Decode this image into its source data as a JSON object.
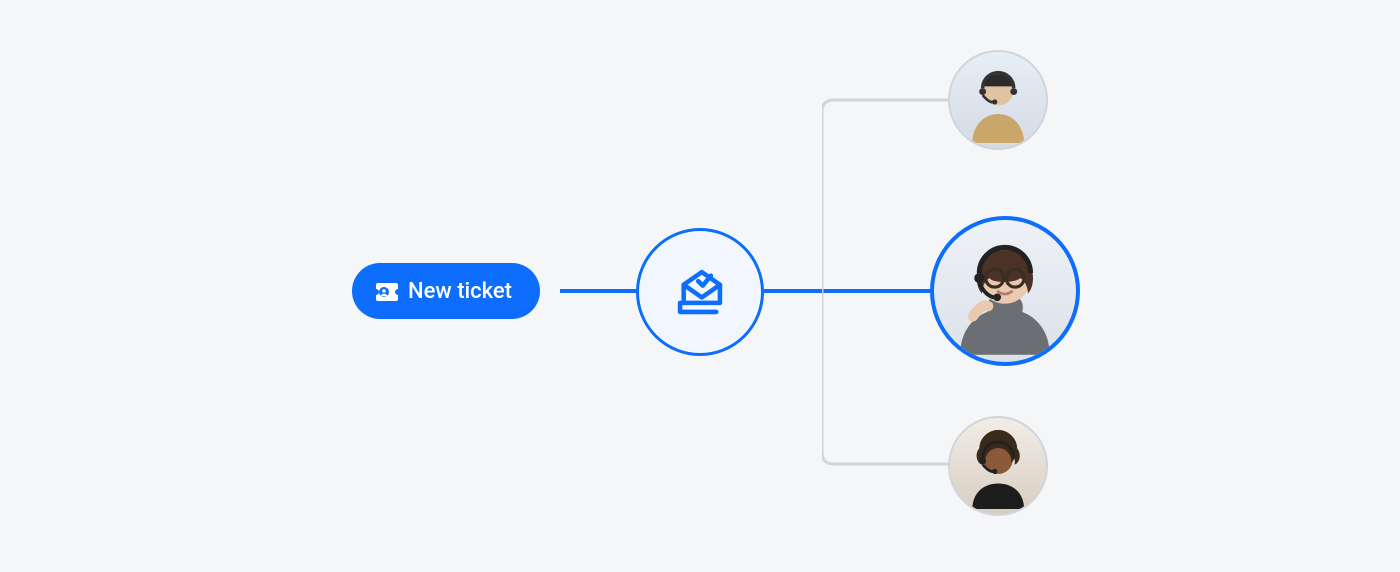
{
  "button": {
    "label": "New ticket",
    "icon": "ticket-icon"
  },
  "routing_node": {
    "icon": "inbox-check-icon"
  },
  "agents": [
    {
      "name": "agent-1",
      "selected": false
    },
    {
      "name": "agent-2",
      "selected": true
    },
    {
      "name": "agent-3",
      "selected": false
    }
  ],
  "colors": {
    "accent": "#0d6efd",
    "muted_line": "#d1d5db",
    "bg": "#f5f6f7"
  }
}
